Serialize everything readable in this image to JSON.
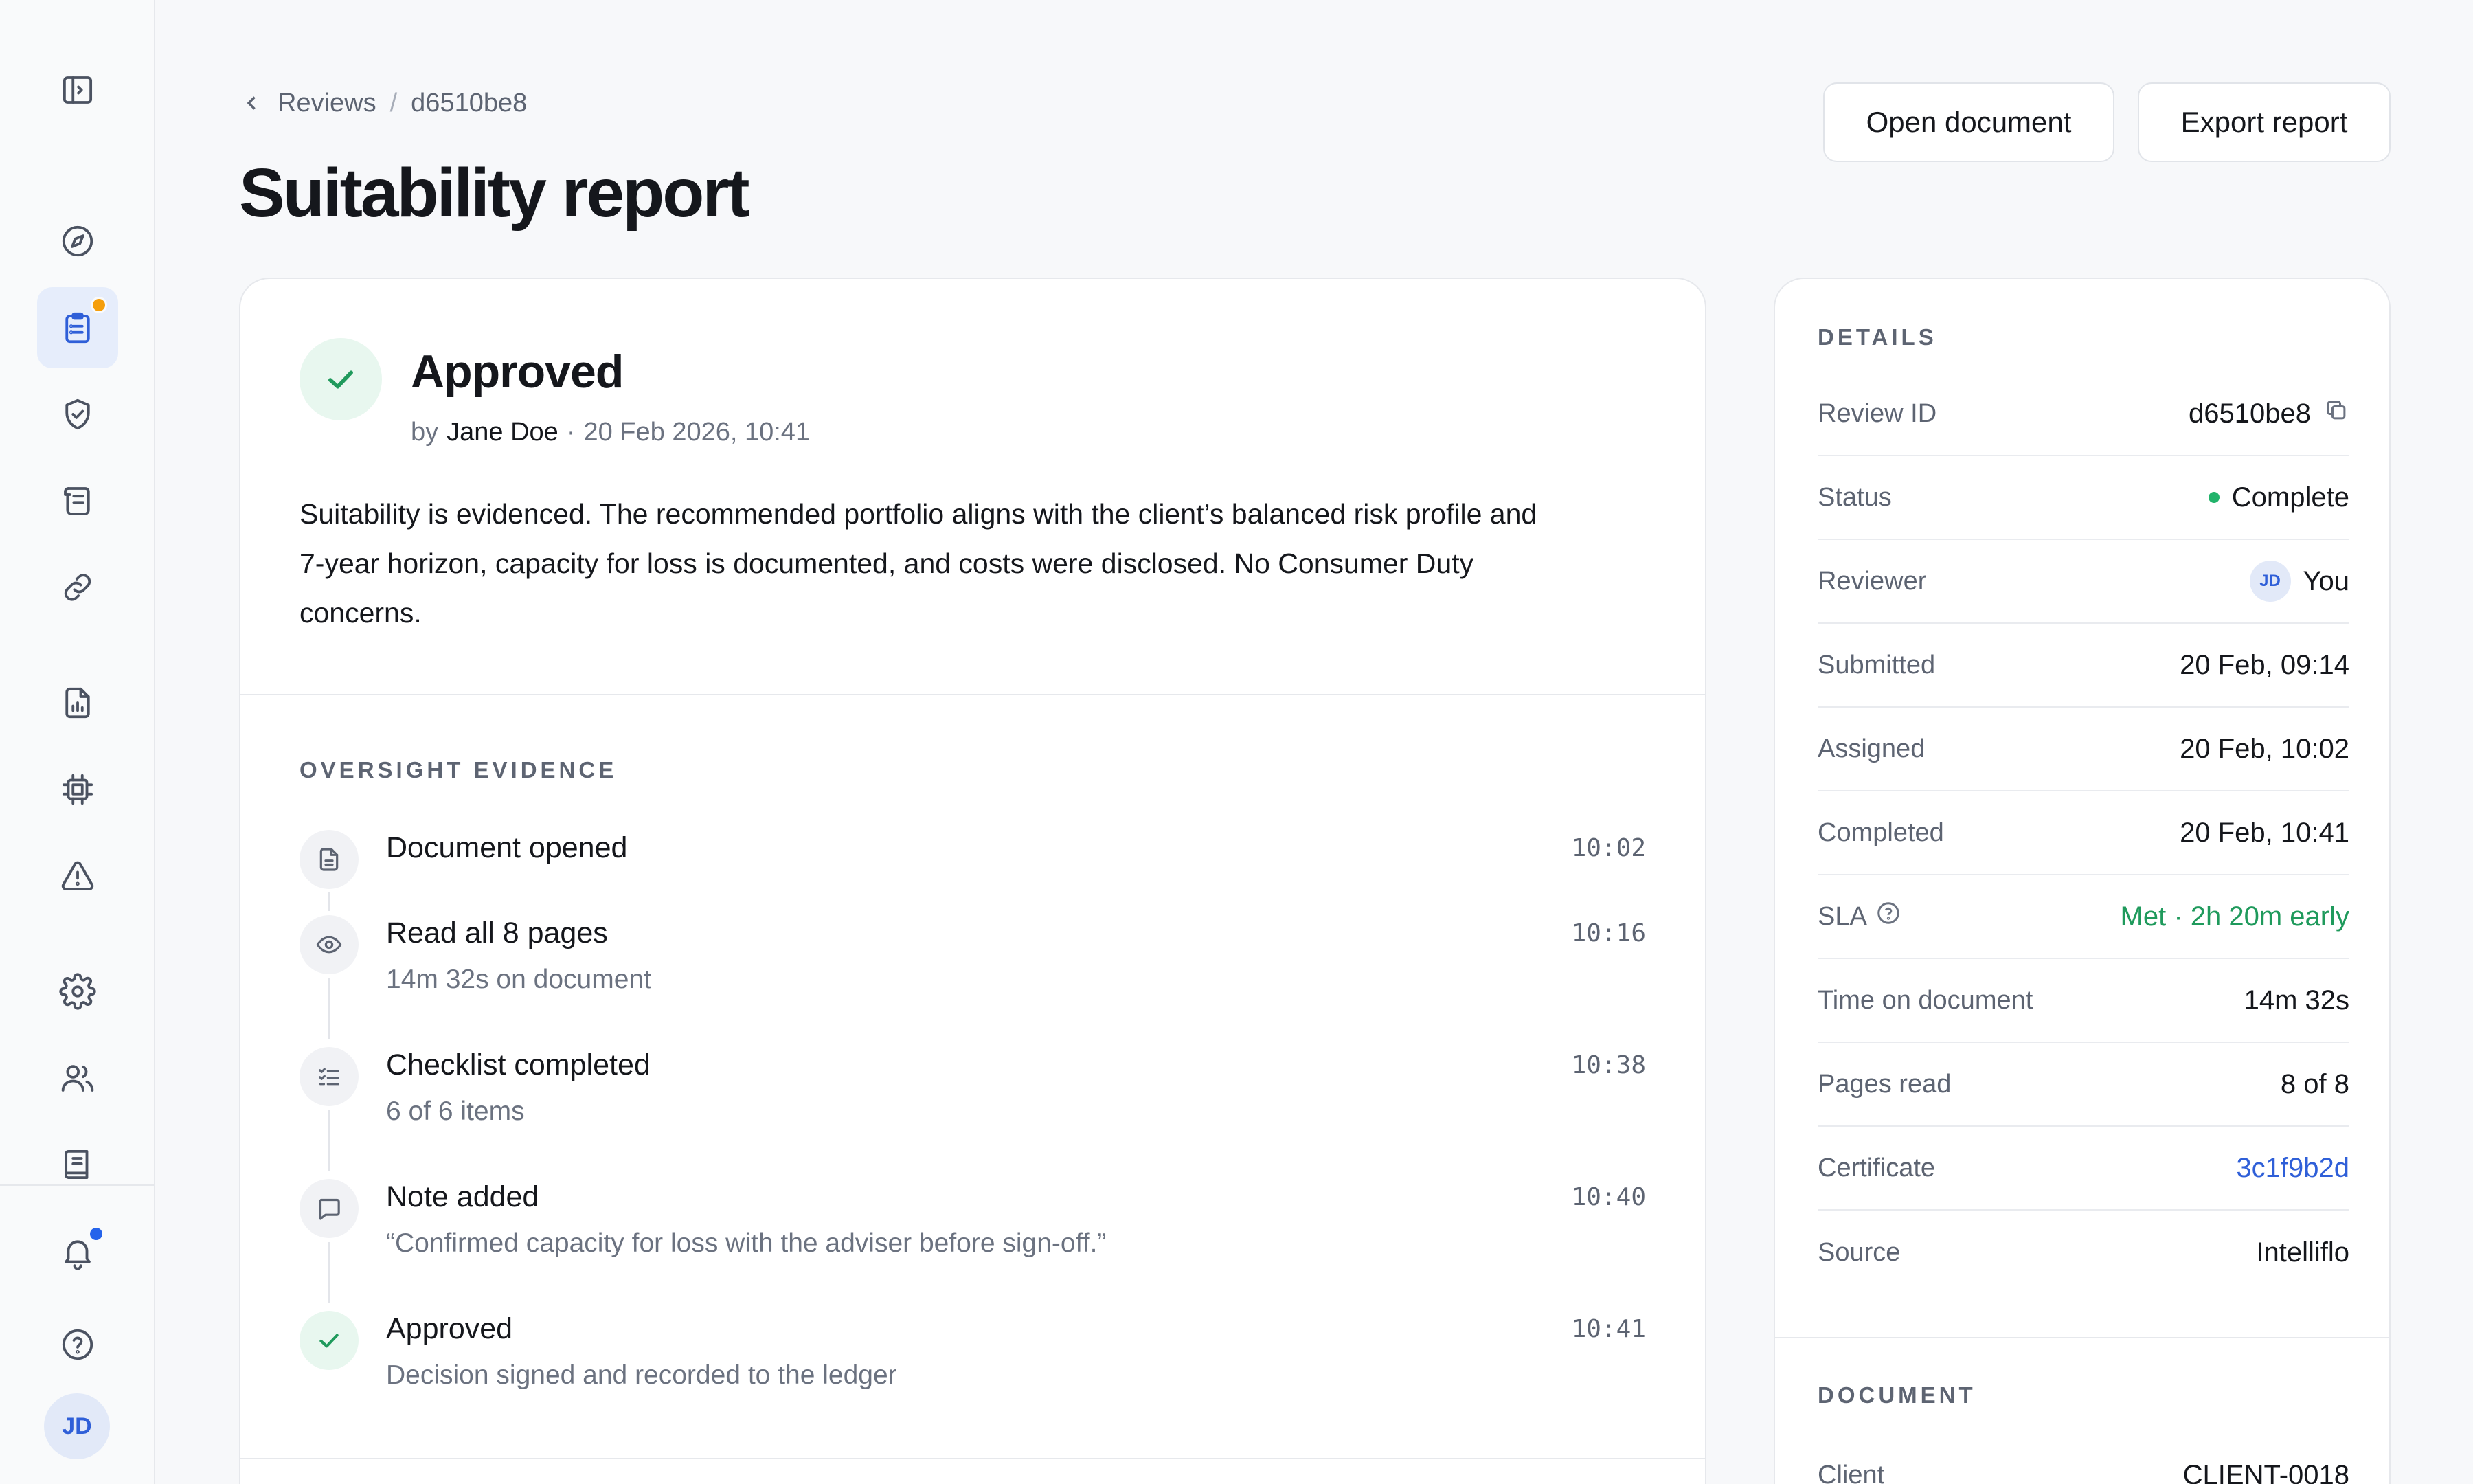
{
  "sidebar": {
    "items": [
      {
        "name": "panel-toggle-icon"
      },
      {
        "name": "compass-icon"
      },
      {
        "name": "clipboard-icon"
      },
      {
        "name": "shield-check-icon"
      },
      {
        "name": "scroll-icon"
      },
      {
        "name": "link-icon"
      },
      {
        "name": "file-chart-icon"
      },
      {
        "name": "chip-icon"
      },
      {
        "name": "alert-triangle-icon"
      },
      {
        "name": "gear-icon"
      },
      {
        "name": "users-icon"
      },
      {
        "name": "book-icon"
      },
      {
        "name": "bell-icon"
      },
      {
        "name": "help-circle-icon"
      }
    ],
    "avatar_initials": "JD",
    "badge_colors": {
      "reviews": "#f59e0b",
      "notifications": "#2563eb"
    }
  },
  "header": {
    "breadcrumb_parent": "Reviews",
    "breadcrumb_sep": "/",
    "breadcrumb_current": "d6510be8",
    "title": "Suitability report",
    "open_document_label": "Open document",
    "export_report_label": "Export report"
  },
  "decision": {
    "status": "Approved",
    "by_prefix": "by",
    "reviewer": "Jane Doe",
    "separator": "·",
    "timestamp": "20 Feb 2026, 10:41",
    "summary": "Suitability is evidenced. The recommended portfolio aligns with the client’s balanced risk profile and 7-year horizon, capacity for loss is documented, and costs were disclosed. No Consumer Duty concerns."
  },
  "evidence": {
    "label": "OVERSIGHT EVIDENCE",
    "items": [
      {
        "title": "Document opened",
        "sub": "",
        "time": "10:02",
        "icon": "document-icon"
      },
      {
        "title": "Read all 8 pages",
        "sub": "14m 32s on document",
        "time": "10:16",
        "icon": "eye-icon"
      },
      {
        "title": "Checklist completed",
        "sub": "6 of 6 items",
        "time": "10:38",
        "icon": "checklist-icon"
      },
      {
        "title": "Note added",
        "sub": "“Confirmed capacity for loss with the adviser before sign-off.”",
        "time": "10:40",
        "icon": "comment-icon"
      },
      {
        "title": "Approved",
        "sub": "Decision signed and recorded to the ledger",
        "time": "10:41",
        "icon": "check-icon"
      }
    ]
  },
  "details": {
    "label": "DETAILS",
    "rows": [
      {
        "key": "Review ID",
        "value": "d6510be8"
      },
      {
        "key": "Status",
        "value": "Complete"
      },
      {
        "key": "Reviewer",
        "value": "You",
        "avatar": "JD"
      },
      {
        "key": "Submitted",
        "value": "20 Feb, 09:14"
      },
      {
        "key": "Assigned",
        "value": "20 Feb, 10:02"
      },
      {
        "key": "Completed",
        "value": "20 Feb, 10:41"
      },
      {
        "key": "SLA",
        "value": "Met · 2h 20m early"
      },
      {
        "key": "Time on document",
        "value": "14m 32s"
      },
      {
        "key": "Pages read",
        "value": "8 of 8"
      },
      {
        "key": "Certificate",
        "value": "3c1f9b2d"
      },
      {
        "key": "Source",
        "value": "Intelliflo"
      }
    ]
  },
  "document": {
    "label": "DOCUMENT",
    "rows": [
      {
        "key": "Client",
        "value": "CLIENT-0018"
      }
    ]
  },
  "colors": {
    "accent": "#2f5fd8",
    "success": "#1f9a5c",
    "background": "#f7f8fa"
  }
}
